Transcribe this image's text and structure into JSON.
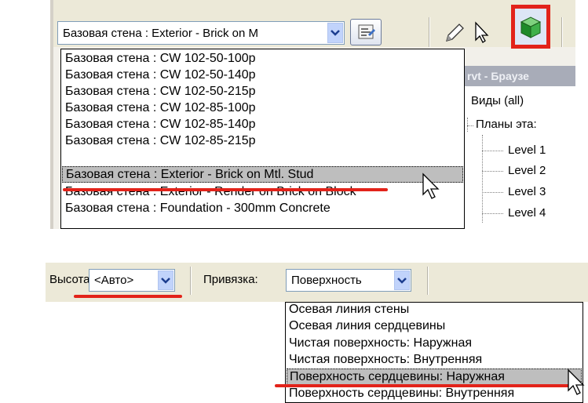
{
  "top_toolbar": {
    "type_selector_value": "Базовая стена : Exterior - Brick on M",
    "type_options": [
      "Базовая стена : CW 102-50-100p",
      "Базовая стена : CW 102-50-140p",
      "Базовая стена : CW 102-50-215p",
      "Базовая стена : CW 102-85-100p",
      "Базовая стена : CW 102-85-140p",
      "Базовая стена : CW 102-85-215p",
      "Базовая стена : Exterior - Brick on Mtl. Stud",
      "Базовая стена : Exterior - Render on Brick on Block",
      "Базовая стена : Foundation - 300mm Concrete"
    ],
    "selected_index": 6,
    "icons": [
      "type-properties-icon",
      "pencil-icon",
      "select-arrow-icon",
      "wall-tool-icon"
    ]
  },
  "project_browser": {
    "title": "rvt - Браузе",
    "root": "Виды (all)",
    "group": "Планы эта:",
    "levels": [
      "Level 1",
      "Level 2",
      "Level 3",
      "Level 4"
    ]
  },
  "options_bar": {
    "height_label": "Высота:",
    "height_value": "<Авто>",
    "snap_label": "Привязка:",
    "snap_value": "Поверхность",
    "snap_options": [
      "Осевая линия стены",
      "Осевая линия сердцевины",
      "Чистая поверхность: Наружная",
      "Чистая поверхность: Внутренняя",
      "Поверхность сердцевины: Наружная",
      "Поверхность сердцевины: Внутренняя"
    ],
    "snap_selected_index": 4
  },
  "colors": {
    "highlight_red": "#e2231a",
    "toolbar": "#ece9d8",
    "combo_button": "#c1d3fb"
  }
}
